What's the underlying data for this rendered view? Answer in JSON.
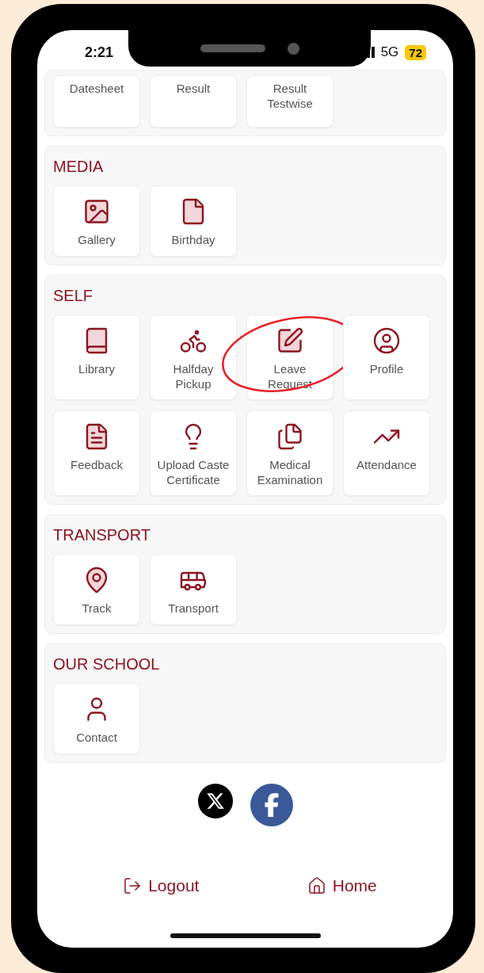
{
  "status_bar": {
    "time": "2:21",
    "network": "5G",
    "battery": "72"
  },
  "partial_section": {
    "tiles": [
      {
        "label": "Datesheet"
      },
      {
        "label": "Result"
      },
      {
        "label": "Result Testwise"
      }
    ]
  },
  "sections": [
    {
      "title": "MEDIA",
      "tiles": [
        {
          "label": "Gallery",
          "kind": "gallery"
        },
        {
          "label": "Birthday",
          "kind": "birthday"
        }
      ]
    },
    {
      "title": "SELF",
      "tiles": [
        {
          "label": "Library",
          "kind": "library"
        },
        {
          "label": "Halfday Pickup",
          "kind": "bike"
        },
        {
          "label": "Leave Request",
          "kind": "leave",
          "circled": true
        },
        {
          "label": "Profile",
          "kind": "profile"
        },
        {
          "label": "Feedback",
          "kind": "feedback"
        },
        {
          "label": "Upload Caste Certificate",
          "kind": "upload"
        },
        {
          "label": "Medical Examination",
          "kind": "medical"
        },
        {
          "label": "Attendance",
          "kind": "attendance"
        }
      ]
    },
    {
      "title": "TRANSPORT",
      "tiles": [
        {
          "label": "Track",
          "kind": "track"
        },
        {
          "label": "Transport",
          "kind": "bus"
        }
      ]
    },
    {
      "title": "OUR SCHOOL",
      "tiles": [
        {
          "label": "Contact",
          "kind": "contact"
        }
      ]
    }
  ],
  "social": [
    {
      "kind": "x"
    },
    {
      "kind": "facebook"
    }
  ],
  "footer": [
    {
      "label": "Logout",
      "kind": "logout"
    },
    {
      "label": "Home",
      "kind": "home"
    }
  ]
}
